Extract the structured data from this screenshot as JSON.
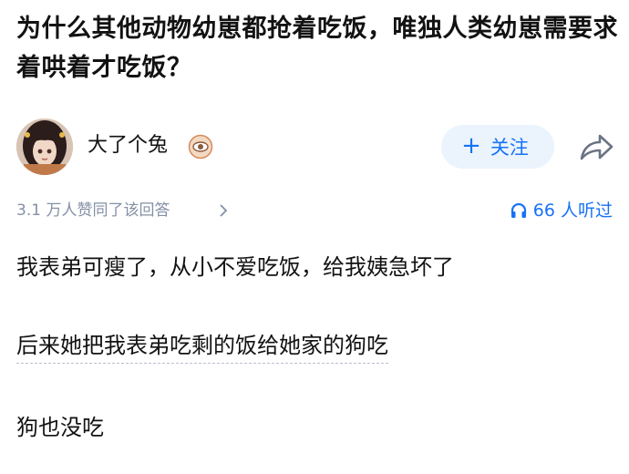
{
  "question": {
    "title": "为什么其他动物幼崽都抢着吃饭，唯独人类幼崽需要求着哄着才吃饭？"
  },
  "author": {
    "name": "大了个兔",
    "badge_icon": "eye-badge-icon",
    "follow_label": "关注",
    "follow_icon": "plus-icon",
    "share_icon": "share-arrow-icon"
  },
  "meta": {
    "agree_text": "3.1 万人赞同了该回答",
    "listen_count": "66",
    "listen_suffix": "人听过"
  },
  "answer": {
    "paragraphs": [
      "我表弟可瘦了，从小不爱吃饭，给我姨急坏了",
      "后来她把我表弟吃剩的饭给她家的狗吃",
      "狗也没吃"
    ]
  },
  "colors": {
    "accent": "#1772f6",
    "follow_bg": "#ebf4fd",
    "meta_text": "#8590a6",
    "text": "#121212"
  }
}
